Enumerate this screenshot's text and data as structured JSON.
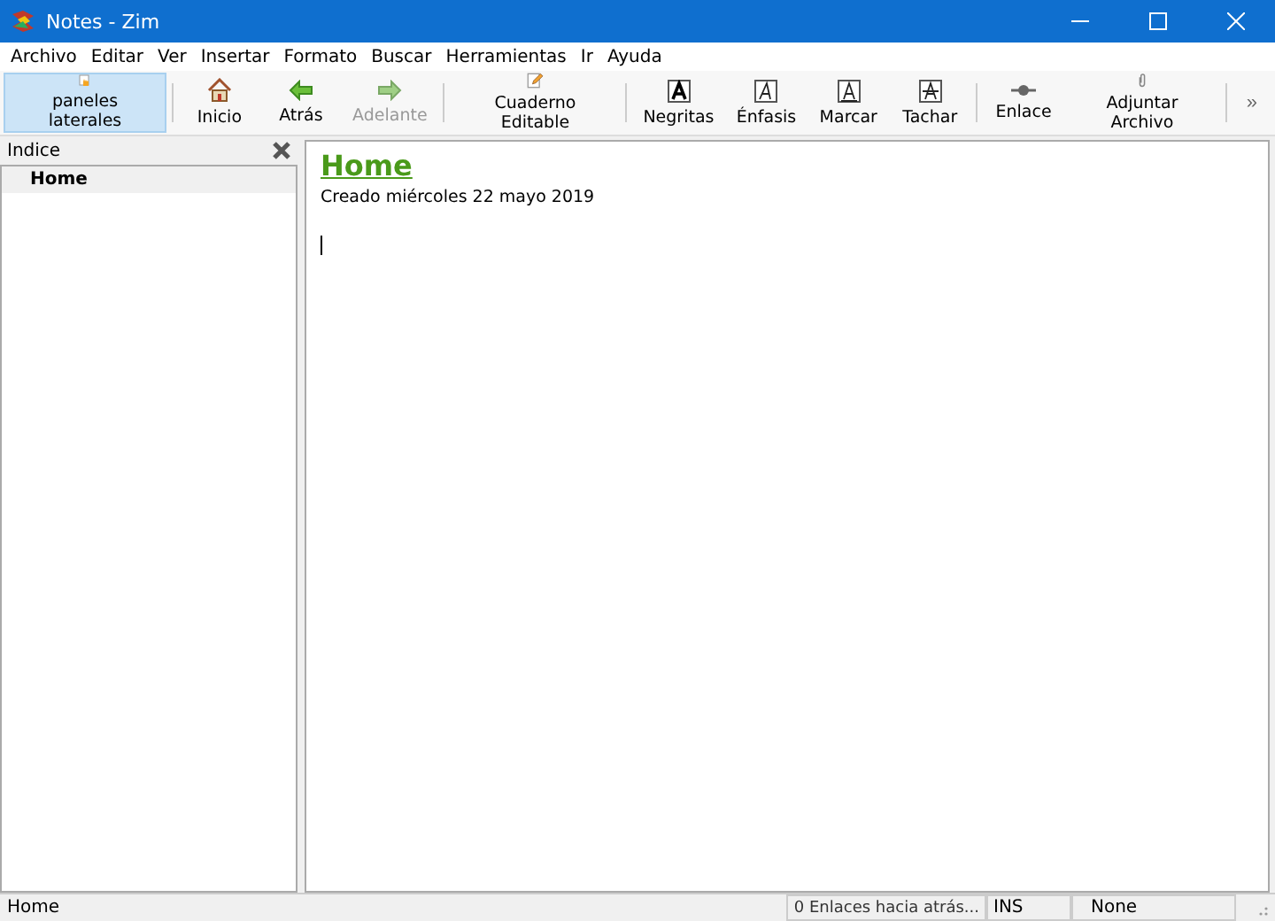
{
  "window": {
    "title": "Notes - Zim"
  },
  "menu": [
    "Archivo",
    "Editar",
    "Ver",
    "Insertar",
    "Formato",
    "Buscar",
    "Herramientas",
    "Ir",
    "Ayuda"
  ],
  "toolbar": {
    "groups": [
      [
        {
          "label": "paneles laterales",
          "kind": "panes",
          "selected": true,
          "disabled": false
        }
      ],
      [
        {
          "label": "Inicio",
          "kind": "home",
          "selected": false,
          "disabled": false
        },
        {
          "label": "Atrás",
          "kind": "back",
          "selected": false,
          "disabled": false
        },
        {
          "label": "Adelante",
          "kind": "forward",
          "selected": false,
          "disabled": true
        }
      ],
      [
        {
          "label": "Cuaderno Editable",
          "kind": "edit",
          "selected": false,
          "disabled": false
        }
      ],
      [
        {
          "label": "Negritas",
          "kind": "bold",
          "selected": false,
          "disabled": false
        },
        {
          "label": "Énfasis",
          "kind": "italic",
          "selected": false,
          "disabled": false
        },
        {
          "label": "Marcar",
          "kind": "mark",
          "selected": false,
          "disabled": false
        },
        {
          "label": "Tachar",
          "kind": "strike",
          "selected": false,
          "disabled": false
        }
      ],
      [
        {
          "label": "Enlace",
          "kind": "link",
          "selected": false,
          "disabled": false
        },
        {
          "label": "Adjuntar Archivo",
          "kind": "attach",
          "selected": false,
          "disabled": false
        }
      ]
    ],
    "overflow": "»"
  },
  "sidebar": {
    "title": "Indice",
    "items": [
      {
        "label": "Home",
        "selected": true
      }
    ]
  },
  "page": {
    "heading": "Home",
    "created": "Creado miércoles 22 mayo 2019"
  },
  "status_bar": {
    "page": "Home",
    "backlinks": "0 Enlaces hacia atrás...",
    "mode": "INS",
    "style": "None"
  }
}
